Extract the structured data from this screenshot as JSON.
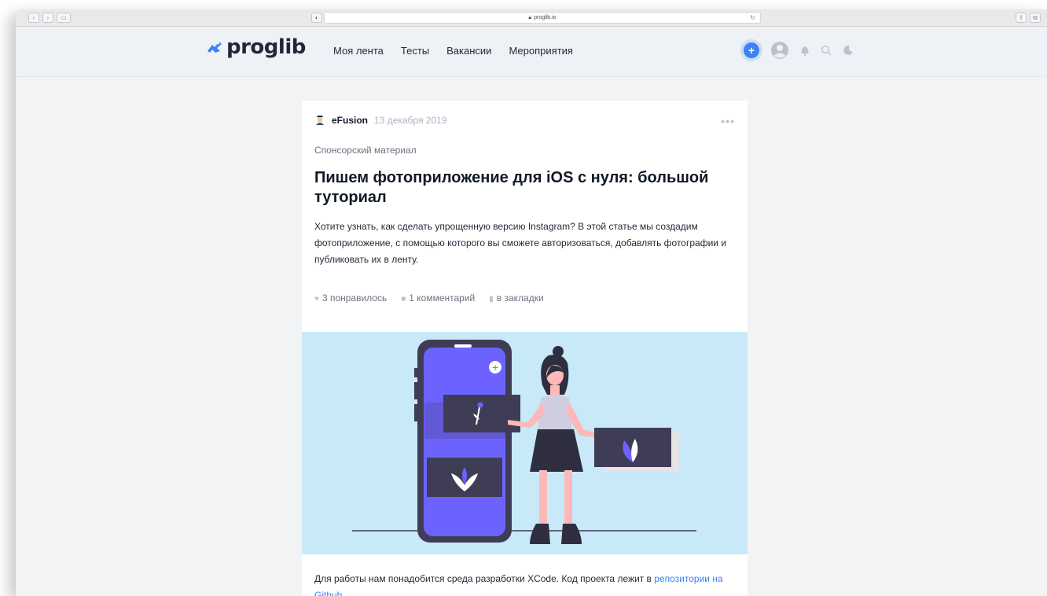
{
  "browser": {
    "url": "proglib.io"
  },
  "site": {
    "logo_text": "proglib",
    "menu": [
      {
        "label": "Моя лента"
      },
      {
        "label": "Тесты"
      },
      {
        "label": "Вакансии"
      },
      {
        "label": "Мероприятия"
      }
    ],
    "tools": {
      "create_icon": "plus-icon",
      "profile_icon": "avatar-icon",
      "notifications_icon": "bell-icon",
      "search_icon": "search-icon",
      "theme_icon": "moon-icon"
    },
    "accent_color": "#3b82f6"
  },
  "post": {
    "author": "eFusion",
    "date": "13 декабря 2019",
    "tag": "Спонсорский материал",
    "title": "Пишем фотоприложение для iOS с нуля: большой туториал",
    "description": "Хотите узнать, как сделать упрощенную версию Instagram? В этой статье мы создадим фотоприложение, с помощью которого вы сможете авторизоваться, добавлять фотографии и публиковать их в ленту.",
    "likes": "3 понравилось",
    "comments": "1 комментарий",
    "bookmarks": "в закладки",
    "body_text": "Для работы нам понадобится среда разработки XCode. Код проекта лежит в",
    "body_link": "репозитории на Github"
  }
}
